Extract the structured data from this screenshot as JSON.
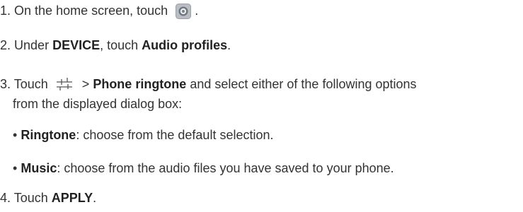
{
  "steps": [
    {
      "number": "1.",
      "text": "On the home screen, touch",
      "end": "."
    },
    {
      "number": "2.",
      "pre": "Under",
      "bold1": "DEVICE",
      "mid": ", touch",
      "bold2": "Audio profiles",
      "end": "."
    },
    {
      "number": "3.",
      "pre": "Touch",
      "sep": ">",
      "bold1": "Phone ringtone",
      "post": "and select either of the following options",
      "continuation": "from the displayed dialog box:"
    },
    {
      "number": "4.",
      "pre": "Touch",
      "bold1": "APPLY",
      "end": "."
    }
  ],
  "options": [
    {
      "bullet": "•",
      "label": "Ringtone",
      "desc": ": choose from the default selection."
    },
    {
      "bullet": "•",
      "label": "Music",
      "desc": ": choose from the audio files you have saved to your phone."
    }
  ],
  "icons": {
    "settings": "settings-gear-icon",
    "adjust": "sliders-adjust-icon"
  }
}
